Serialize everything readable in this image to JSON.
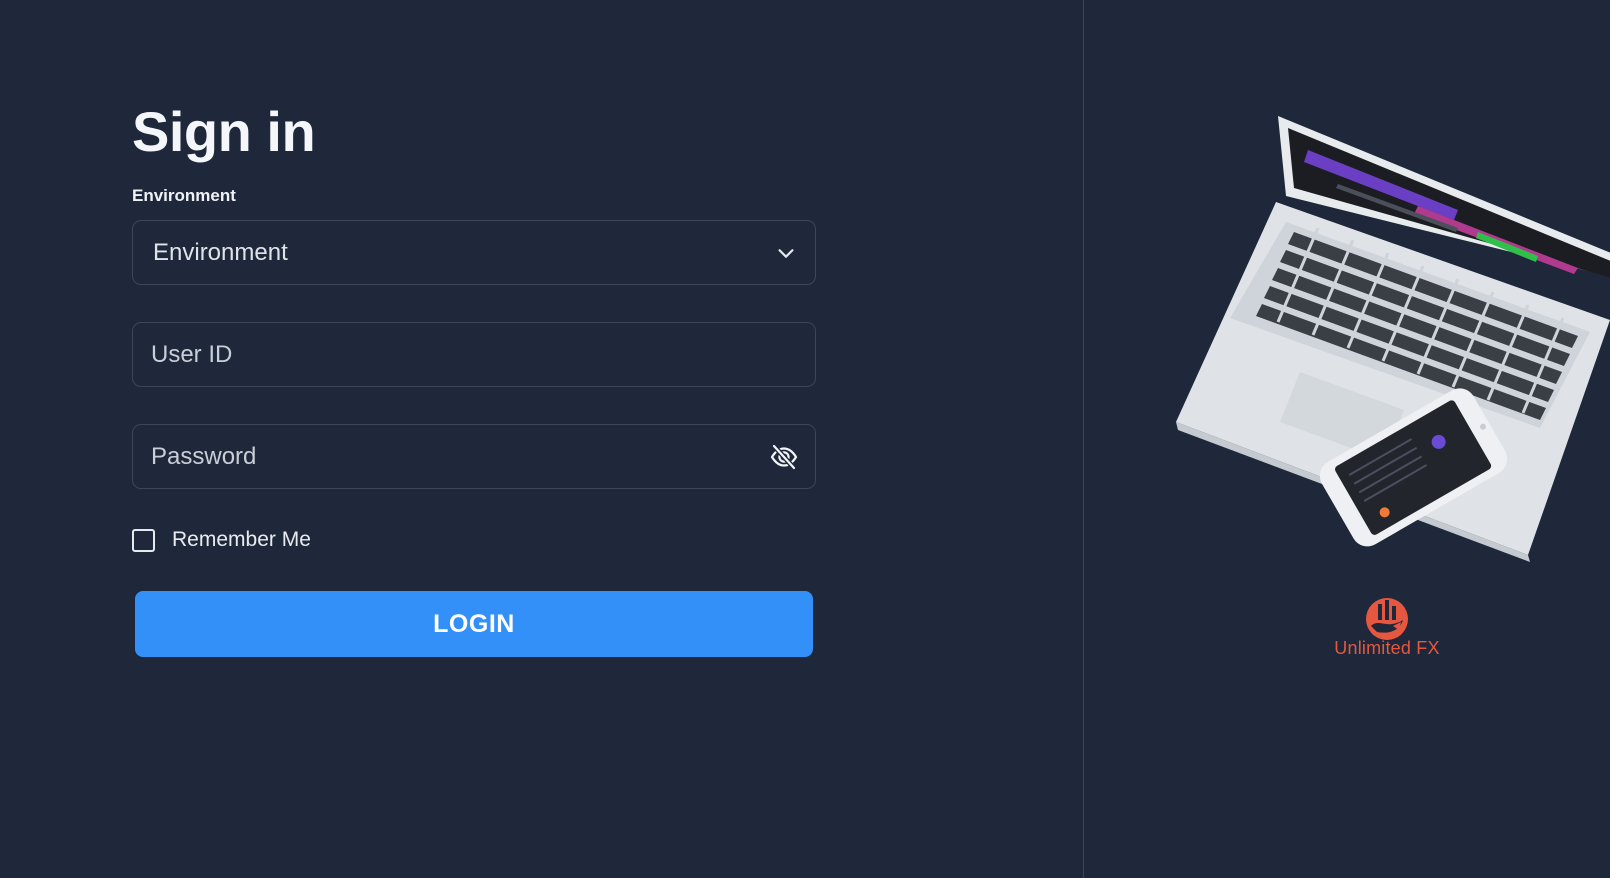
{
  "signin": {
    "title": "Sign in",
    "environment_label": "Environment",
    "environment_select": {
      "selected": "Environment"
    },
    "user_id": {
      "placeholder": "User ID"
    },
    "password": {
      "placeholder": "Password"
    },
    "remember_me": {
      "label": "Remember Me",
      "checked": false
    },
    "login_button": "LOGIN"
  },
  "branding": {
    "name": "Unlimited FX",
    "brand_color": "#e5573f"
  },
  "icons": {
    "dropdown": "chevron-down-icon",
    "password_toggle": "eye-off-icon",
    "logo": "unlimited-fx-logo"
  },
  "colors": {
    "background": "#1e283a",
    "accent": "#3290f8",
    "border": "#3b4658"
  }
}
